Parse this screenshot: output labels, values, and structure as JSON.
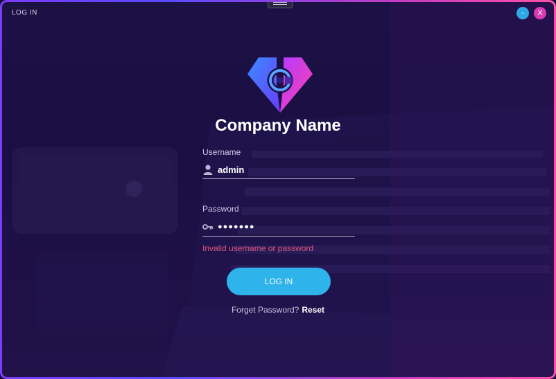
{
  "window": {
    "title": "LOG IN",
    "minimize_label": "-",
    "close_label": "X"
  },
  "brand": {
    "company_name": "Company Name",
    "logo_icon": "diamond-c-logo-icon",
    "logo_colors": [
      "#2f7bff",
      "#8a3cff",
      "#ff3fb0"
    ]
  },
  "form": {
    "username_label": "Username",
    "username_value": "admin",
    "username_icon": "user-icon",
    "password_label": "Password",
    "password_value": "●●●●●●●",
    "password_icon": "key-icon",
    "error_message": "Invalid username or password",
    "login_button": "LOG IN",
    "forgot_text": "Forget Password?",
    "reset_link": "Reset"
  },
  "colors": {
    "accent": "#2eb3ea",
    "error": "#e0557e",
    "close": "#d63bb0"
  }
}
